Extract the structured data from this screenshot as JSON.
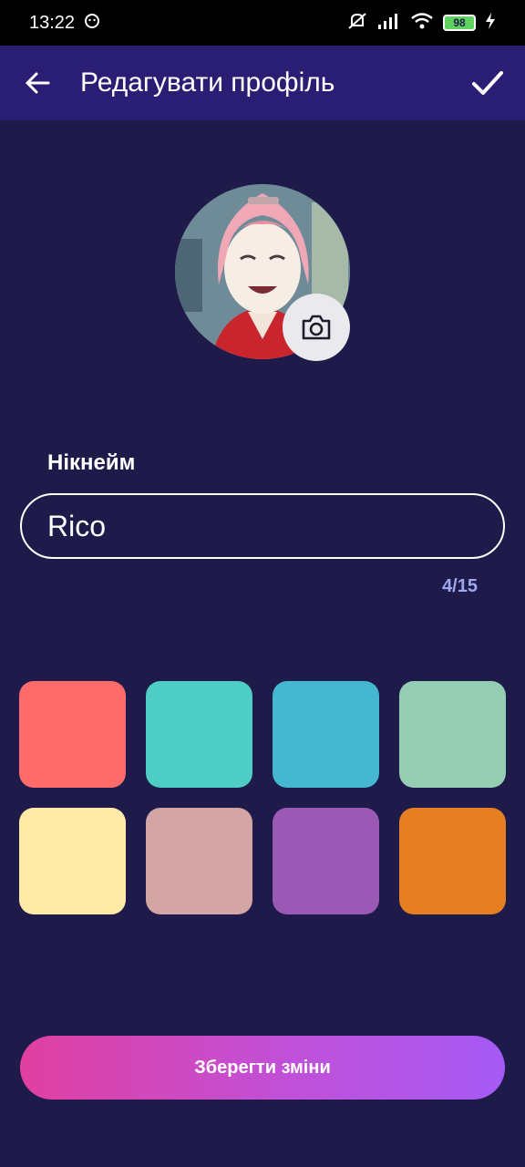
{
  "status_bar": {
    "time": "13:22",
    "battery": "98"
  },
  "header": {
    "title": "Редагувати профіль",
    "back_icon": "arrow-left-icon",
    "confirm_icon": "check-icon"
  },
  "profile": {
    "avatar": "avatar-image",
    "camera_icon": "camera-icon"
  },
  "form": {
    "nickname_label": "Нікнейм",
    "nickname_value": "Rico",
    "char_counter": "4/15"
  },
  "colors": [
    "#ff6b6b",
    "#4ecdc4",
    "#45b7d1",
    "#96ceb4",
    "#ffeaa7",
    "#d4a5a5",
    "#9b59b6",
    "#e67e22"
  ],
  "actions": {
    "save_label": "Зберегти зміни"
  }
}
